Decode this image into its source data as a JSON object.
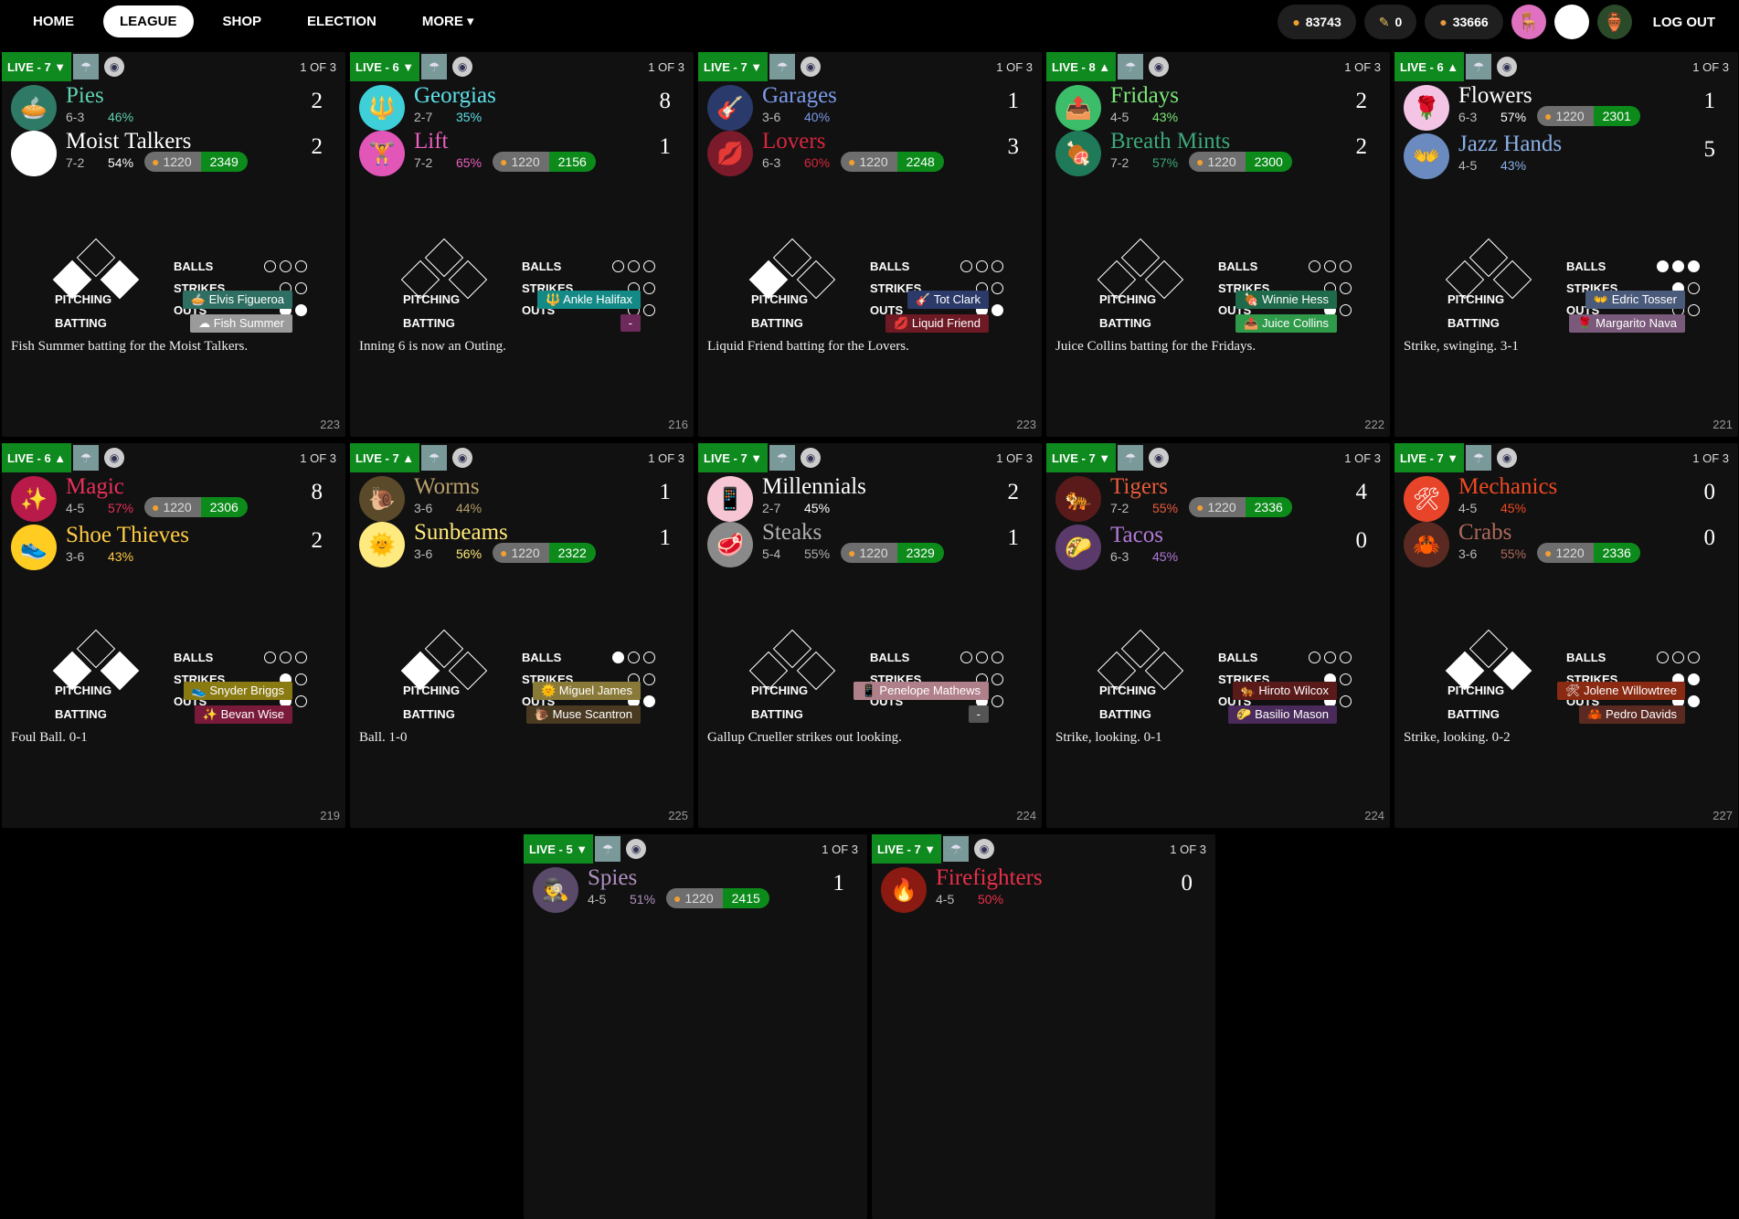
{
  "nav": {
    "home": "HOME",
    "league": "LEAGUE",
    "shop": "SHOP",
    "election": "ELECTION",
    "more": "MORE ▾"
  },
  "user": {
    "coins": "83743",
    "votes": "0",
    "peanuts": "33666",
    "logout": "LOG OUT"
  },
  "labels": {
    "balls": "BALLS",
    "strikes": "STRIKES",
    "outs": "OUTS",
    "pitching": "PITCHING",
    "batting": "BATTING",
    "of": "1 OF 3",
    "odds": "1220"
  },
  "games": [
    {
      "live": "LIVE - 7 ▼",
      "away": {
        "name": "Pies",
        "rec": "6-3",
        "pct": "46%",
        "score": "2",
        "color": "#5fd0b0",
        "logo": "🥧",
        "bg": "#2f7a67"
      },
      "home": {
        "name": "Moist Talkers",
        "rec": "7-2",
        "pct": "54%",
        "score": "2",
        "color": "#ffffff",
        "logo": "",
        "bg": "#ffffff",
        "bet": "2349"
      },
      "balls": 0,
      "strikes": 0,
      "outs": 2,
      "bases": [
        1,
        0,
        1
      ],
      "pitching": {
        "name": "Elvis Figueroa",
        "icon": "🥧",
        "bg": "#2f6e62"
      },
      "batting": {
        "name": "Fish Summer",
        "icon": "☁",
        "bg": "#9a9a9a"
      },
      "update": "Fish Summer batting for the Moist Talkers.",
      "num": "223"
    },
    {
      "live": "LIVE - 6 ▼",
      "away": {
        "name": "Georgias",
        "rec": "2-7",
        "pct": "35%",
        "score": "8",
        "color": "#5ee0e8",
        "logo": "🔱",
        "bg": "#3ecfd8"
      },
      "home": {
        "name": "Lift",
        "rec": "7-2",
        "pct": "65%",
        "score": "1",
        "color": "#e85fbd",
        "logo": "🏋",
        "bg": "#e256b8",
        "bet": "2156"
      },
      "balls": 0,
      "strikes": 0,
      "outs": 0,
      "bases": [
        0,
        0,
        0
      ],
      "pitching": {
        "name": "Ankle Halifax",
        "icon": "🔱",
        "bg": "#148a86"
      },
      "batting": {
        "name": "-",
        "icon": "",
        "bg": "#6e2a5a"
      },
      "update": "Inning 6 is now an Outing.",
      "num": "216"
    },
    {
      "live": "LIVE - 7 ▼",
      "away": {
        "name": "Garages",
        "rec": "3-6",
        "pct": "40%",
        "score": "1",
        "color": "#7b9ae8",
        "logo": "🎸",
        "bg": "#2a3a6a"
      },
      "home": {
        "name": "Lovers",
        "rec": "6-3",
        "pct": "60%",
        "score": "3",
        "color": "#d7263d",
        "logo": "💋",
        "bg": "#7a1a2a",
        "bet": "2248"
      },
      "balls": 0,
      "strikes": 0,
      "outs": 2,
      "bases": [
        0,
        0,
        1
      ],
      "pitching": {
        "name": "Tot Clark",
        "icon": "🎸",
        "bg": "#2c3a6a"
      },
      "batting": {
        "name": "Liquid Friend",
        "icon": "💋",
        "bg": "#6e1a25"
      },
      "update": "Liquid Friend batting for the Lovers.",
      "num": "223"
    },
    {
      "live": "LIVE - 8 ▲",
      "away": {
        "name": "Fridays",
        "rec": "4-5",
        "pct": "43%",
        "score": "2",
        "color": "#7de87a",
        "logo": "📤",
        "bg": "#3bbd6a"
      },
      "home": {
        "name": "Breath Mints",
        "rec": "7-2",
        "pct": "57%",
        "score": "2",
        "color": "#3ca87a",
        "logo": "🍖",
        "bg": "#1f7a5a",
        "bet": "2300"
      },
      "balls": 0,
      "strikes": 0,
      "outs": 1,
      "bases": [
        0,
        0,
        0
      ],
      "pitching": {
        "name": "Winnie Hess",
        "icon": "🍖",
        "bg": "#1f6a4a"
      },
      "batting": {
        "name": "Juice Collins",
        "icon": "📤",
        "bg": "#2f9a4a"
      },
      "update": "Juice Collins batting for the Fridays.",
      "num": "222"
    },
    {
      "live": "LIVE - 6 ▲",
      "away": {
        "name": "Flowers",
        "rec": "6-3",
        "pct": "57%",
        "score": "1",
        "color": "#ffffff",
        "logo": "🌹",
        "bg": "#f4c4e4",
        "bet": "2301"
      },
      "home": {
        "name": "Jazz Hands",
        "rec": "4-5",
        "pct": "43%",
        "score": "5",
        "color": "#8ab0e8",
        "logo": "👐",
        "bg": "#6a8ac0"
      },
      "balls": 3,
      "strikes": 1,
      "outs": 0,
      "bases": [
        0,
        0,
        0
      ],
      "pitching": {
        "name": "Edric Tosser",
        "icon": "👐",
        "bg": "#4a5a7a"
      },
      "batting": {
        "name": "Margarito Nava",
        "icon": "🌹",
        "bg": "#7a5a7a"
      },
      "update": "Strike, swinging. 3-1",
      "num": "221"
    },
    {
      "live": "LIVE - 6 ▲",
      "away": {
        "name": "Magic",
        "rec": "4-5",
        "pct": "57%",
        "score": "8",
        "color": "#e8305a",
        "logo": "✨",
        "bg": "#b81a4a",
        "bet": "2306"
      },
      "home": {
        "name": "Shoe Thieves",
        "rec": "3-6",
        "pct": "43%",
        "score": "2",
        "color": "#ffcc44",
        "logo": "👟",
        "bg": "#ffcc22"
      },
      "balls": 0,
      "strikes": 1,
      "outs": 1,
      "bases": [
        1,
        0,
        1
      ],
      "pitching": {
        "name": "Snyder Briggs",
        "icon": "👟",
        "bg": "#8a7a12"
      },
      "batting": {
        "name": "Bevan Wise",
        "icon": "✨",
        "bg": "#7a1a3a"
      },
      "update": "Foul Ball. 0-1",
      "num": "219"
    },
    {
      "live": "LIVE - 7 ▲",
      "away": {
        "name": "Worms",
        "rec": "3-6",
        "pct": "44%",
        "score": "1",
        "color": "#b9a06a",
        "logo": "🐌",
        "bg": "#5a4a2a"
      },
      "home": {
        "name": "Sunbeams",
        "rec": "3-6",
        "pct": "56%",
        "score": "1",
        "color": "#ffea7a",
        "logo": "🌞",
        "bg": "#ffea80",
        "bet": "2322"
      },
      "balls": 1,
      "strikes": 0,
      "outs": 2,
      "bases": [
        0,
        0,
        1
      ],
      "pitching": {
        "name": "Miguel James",
        "icon": "🌞",
        "bg": "#8a7a3a"
      },
      "batting": {
        "name": "Muse Scantron",
        "icon": "🐌",
        "bg": "#4a3a22"
      },
      "update": "Ball. 1-0",
      "num": "225"
    },
    {
      "live": "LIVE - 7 ▼",
      "away": {
        "name": "Millennials",
        "rec": "2-7",
        "pct": "45%",
        "score": "2",
        "color": "#ffffff",
        "logo": "📱",
        "bg": "#f7c6d4"
      },
      "home": {
        "name": "Steaks",
        "rec": "5-4",
        "pct": "55%",
        "score": "1",
        "color": "#b0b0b0",
        "logo": "🥩",
        "bg": "#8a8a8a",
        "bet": "2329"
      },
      "balls": 0,
      "strikes": 0,
      "outs": 1,
      "bases": [
        0,
        0,
        0
      ],
      "pitching": {
        "name": "Penelope Mathews",
        "icon": "📱",
        "bg": "#b0808a"
      },
      "batting": {
        "name": "-",
        "icon": "",
        "bg": "#555"
      },
      "update": "Gallup Crueller strikes out looking.",
      "num": "224"
    },
    {
      "live": "LIVE - 7 ▼",
      "away": {
        "name": "Tigers",
        "rec": "7-2",
        "pct": "55%",
        "score": "4",
        "color": "#e85a3a",
        "logo": "🐅",
        "bg": "#5a1a1a",
        "bet": "2336"
      },
      "home": {
        "name": "Tacos",
        "rec": "6-3",
        "pct": "45%",
        "score": "0",
        "color": "#b27ad8",
        "logo": "🌮",
        "bg": "#5a3a6a"
      },
      "balls": 0,
      "strikes": 1,
      "outs": 1,
      "bases": [
        0,
        0,
        0
      ],
      "pitching": {
        "name": "Hiroto Wilcox",
        "icon": "🐅",
        "bg": "#5a1a1a"
      },
      "batting": {
        "name": "Basilio Mason",
        "icon": "🌮",
        "bg": "#4a2a5a"
      },
      "update": "Strike, looking. 0-1",
      "num": "224"
    },
    {
      "live": "LIVE - 7 ▼",
      "away": {
        "name": "Mechanics",
        "rec": "4-5",
        "pct": "45%",
        "score": "0",
        "color": "#f04a22",
        "logo": "🛠",
        "bg": "#e8442a"
      },
      "home": {
        "name": "Crabs",
        "rec": "3-6",
        "pct": "55%",
        "score": "0",
        "color": "#b06a5a",
        "logo": "🦀",
        "bg": "#5a2a22",
        "bet": "2336"
      },
      "balls": 0,
      "strikes": 2,
      "outs": 2,
      "bases": [
        1,
        0,
        1
      ],
      "pitching": {
        "name": "Jolene Willowtree",
        "icon": "🛠",
        "bg": "#8a2a12"
      },
      "batting": {
        "name": "Pedro Davids",
        "icon": "🦀",
        "bg": "#5a2a22"
      },
      "update": "Strike, looking. 0-2",
      "num": "227"
    },
    {
      "live": "LIVE - 5 ▼",
      "away": {
        "name": "Spies",
        "rec": "4-5",
        "pct": "51%",
        "score": "1",
        "color": "#b090c0",
        "logo": "🕵",
        "bg": "#5a4a6a",
        "bet": "2415"
      },
      "home": null
    },
    {
      "live": "LIVE - 7 ▼",
      "away": {
        "name": "Firefighters",
        "rec": "4-5",
        "pct": "50%",
        "score": "0",
        "color": "#e8304a",
        "logo": "🔥",
        "bg": "#8a1a12"
      },
      "home": null
    }
  ]
}
